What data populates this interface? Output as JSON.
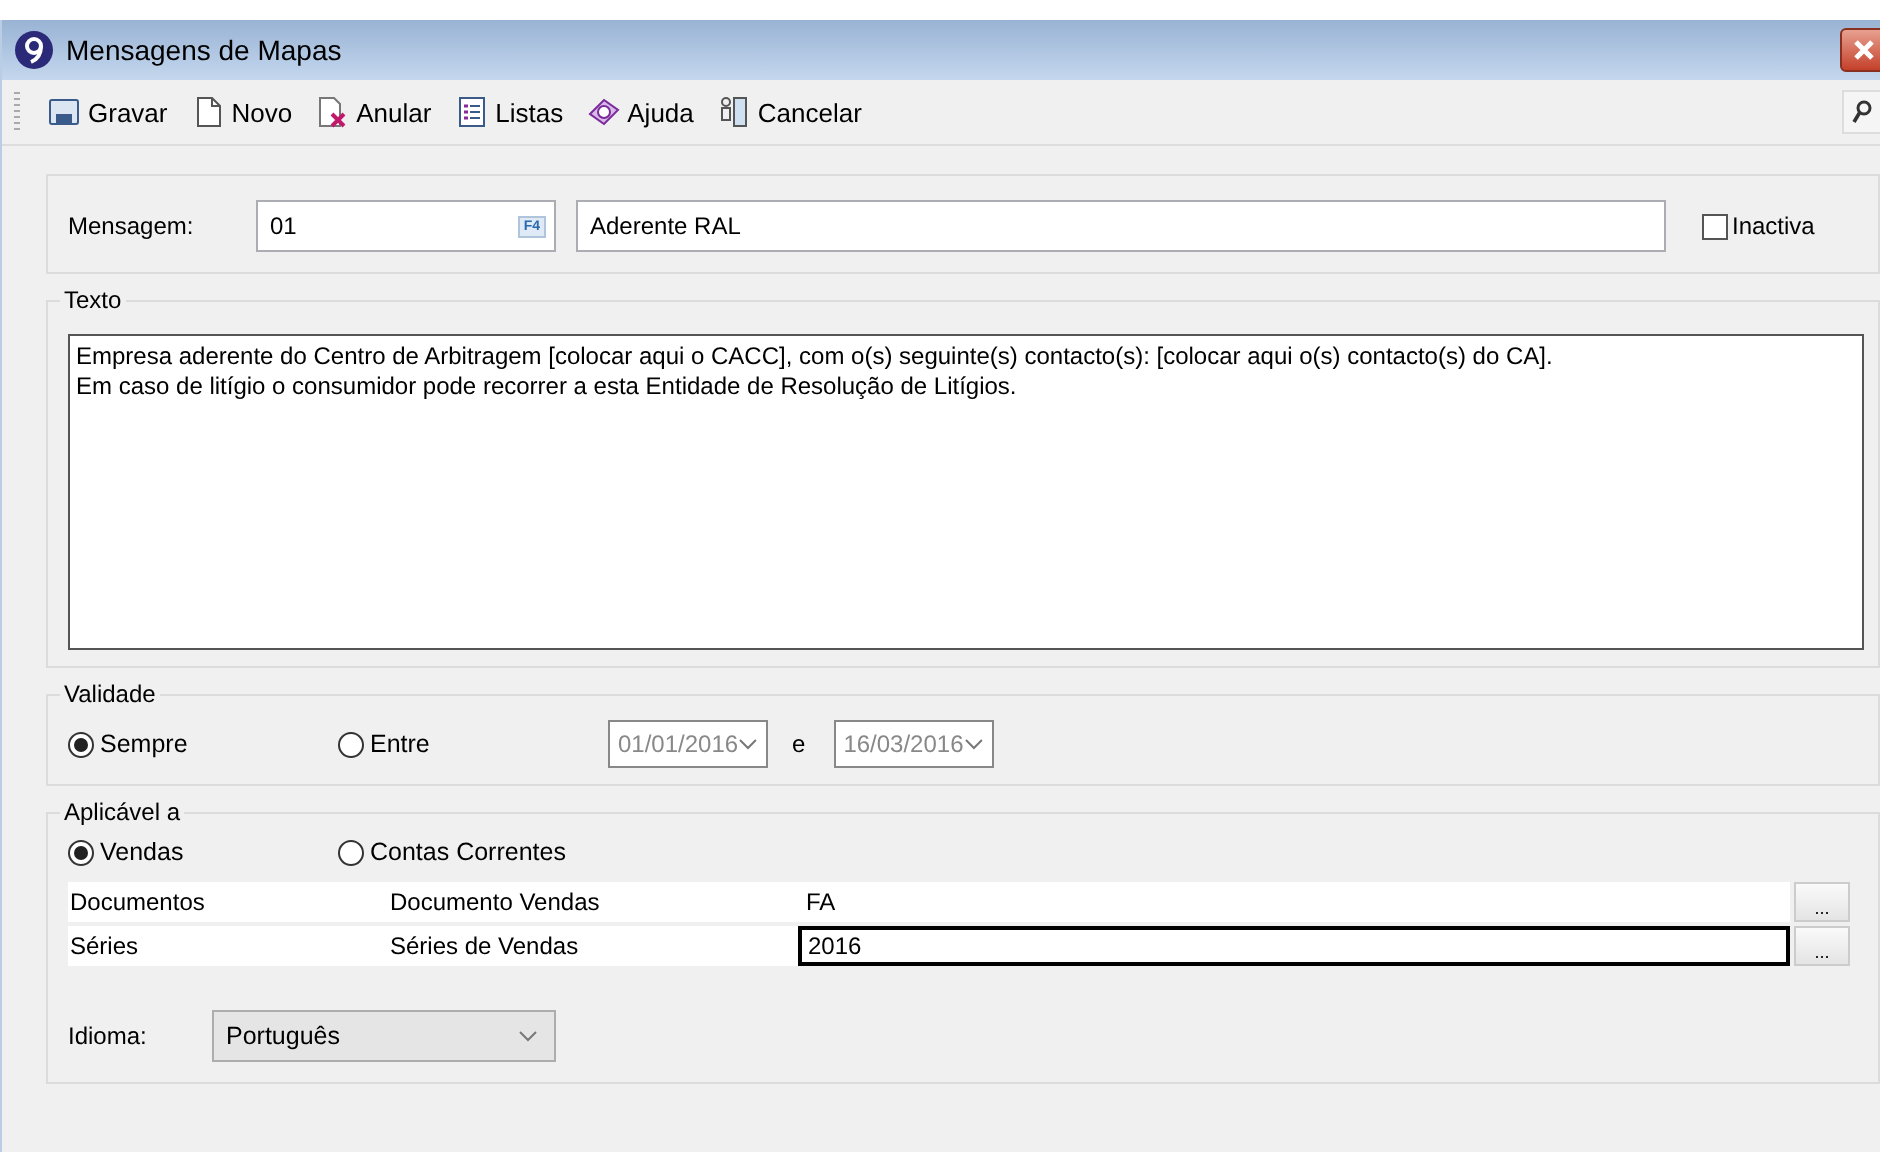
{
  "window": {
    "title": "Mensagens de Mapas"
  },
  "toolbar": [
    {
      "kind": "save",
      "label": "Gravar"
    },
    {
      "kind": "new",
      "label": "Novo"
    },
    {
      "kind": "cancel-doc",
      "label": "Anular"
    },
    {
      "kind": "list",
      "label": "Listas"
    },
    {
      "kind": "help",
      "label": "Ajuda"
    },
    {
      "kind": "exit",
      "label": "Cancelar"
    }
  ],
  "message": {
    "label": "Mensagem:",
    "code": "01",
    "lookup_key": "F4",
    "description": "Aderente RAL",
    "inactive": {
      "label": "Inactiva",
      "checked": false
    }
  },
  "text": {
    "legend": "Texto",
    "lines": [
      "Empresa aderente do Centro de Arbitragem [colocar aqui o CACC], com o(s) seguinte(s) contacto(s): [colocar aqui o(s) contacto(s) do CA].",
      "Em caso de litígio o consumidor pode recorrer a esta Entidade de Resolução de Litígios."
    ]
  },
  "validity": {
    "legend": "Validade",
    "options": [
      {
        "label": "Sempre",
        "selected": true
      },
      {
        "label": "Entre",
        "selected": false
      }
    ],
    "from": {
      "value": "01/01/2016",
      "disabled": true
    },
    "joiner": "e",
    "to": {
      "value": "16/03/2016",
      "disabled": true
    }
  },
  "applies_to": {
    "legend": "Aplicável a",
    "options": [
      {
        "label": "Vendas",
        "selected": true
      },
      {
        "label": "Contas Correntes",
        "selected": false
      }
    ],
    "rows": [
      {
        "column_1": "Documentos",
        "column_2": "Documento Vendas",
        "value": "FA",
        "button": "...",
        "selected": false
      },
      {
        "column_1": "Séries",
        "column_2": "Séries de Vendas",
        "value": "2016",
        "button": "...",
        "selected": true
      }
    ],
    "language": {
      "label": "Idioma:",
      "value": "Português"
    }
  }
}
